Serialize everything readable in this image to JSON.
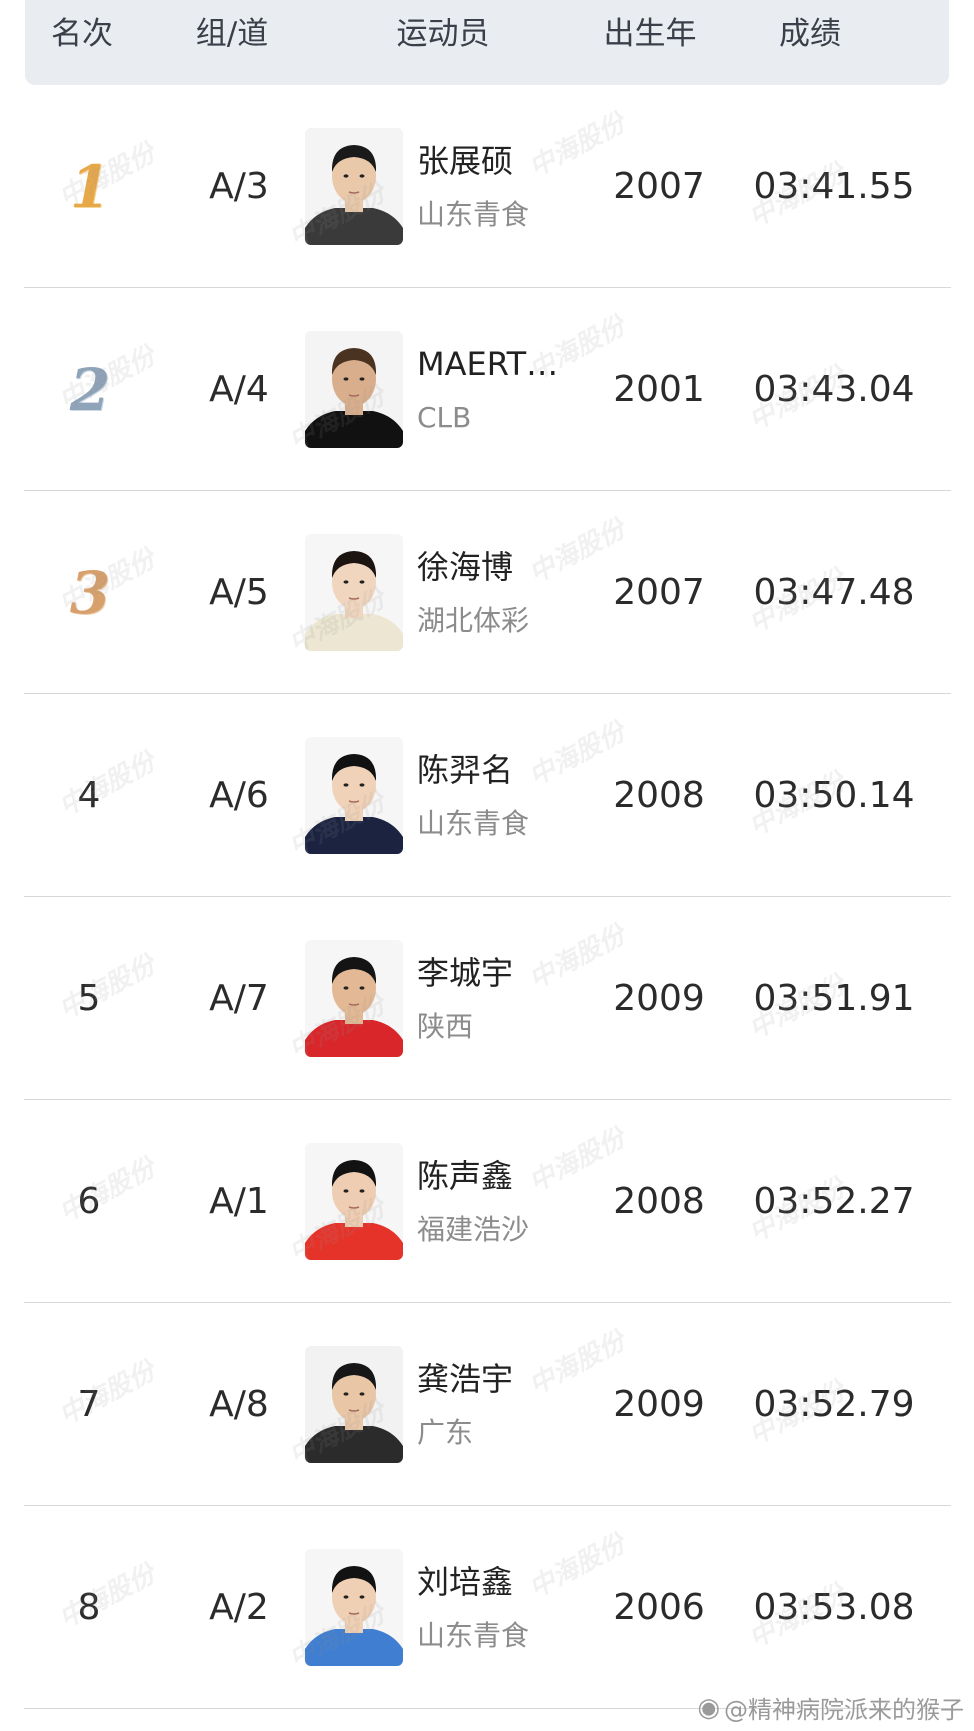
{
  "header": {
    "rank": "名次",
    "lane": "组/道",
    "athlete": "运动员",
    "birth_year": "出生年",
    "result": "成绩"
  },
  "rows": [
    {
      "rank": "1",
      "medal": "gold",
      "lane": "A/3",
      "name": "张展硕",
      "team": "山东青食",
      "year": "2007",
      "time": "03:41.55",
      "avatar": {
        "bg": "#f4f4f4",
        "shirt": "#3a3a3a",
        "hair": "#1a1a1a",
        "skin": "#e9c9aa"
      }
    },
    {
      "rank": "2",
      "medal": "silver",
      "lane": "A/4",
      "name": "MAERT…",
      "team": "CLB",
      "year": "2001",
      "time": "03:43.04",
      "avatar": {
        "bg": "#f4f4f4",
        "shirt": "#111111",
        "hair": "#4a3320",
        "skin": "#d9ae8c"
      }
    },
    {
      "rank": "3",
      "medal": "bronze",
      "lane": "A/5",
      "name": "徐海博",
      "team": "湖北体彩",
      "year": "2007",
      "time": "03:47.48",
      "avatar": {
        "bg": "#f6f6f6",
        "shirt": "#ece6d2",
        "hair": "#1c1410",
        "skin": "#f1d6bf"
      }
    },
    {
      "rank": "4",
      "medal": "",
      "lane": "A/6",
      "name": "陈羿名",
      "team": "山东青食",
      "year": "2008",
      "time": "03:50.14",
      "avatar": {
        "bg": "#f6f6f6",
        "shirt": "#1b2340",
        "hair": "#111111",
        "skin": "#f0d2b8"
      }
    },
    {
      "rank": "5",
      "medal": "",
      "lane": "A/7",
      "name": "李城宇",
      "team": "陕西",
      "year": "2009",
      "time": "03:51.91",
      "avatar": {
        "bg": "#f6f6f6",
        "shirt": "#d8262a",
        "hair": "#141414",
        "skin": "#e3b995"
      }
    },
    {
      "rank": "6",
      "medal": "",
      "lane": "A/1",
      "name": "陈声鑫",
      "team": "福建浩沙",
      "year": "2008",
      "time": "03:52.27",
      "avatar": {
        "bg": "#f6f6f6",
        "shirt": "#e6332a",
        "hair": "#121212",
        "skin": "#efcdb2"
      }
    },
    {
      "rank": "7",
      "medal": "",
      "lane": "A/8",
      "name": "龚浩宇",
      "team": "广东",
      "year": "2009",
      "time": "03:52.79",
      "avatar": {
        "bg": "#f2f2f2",
        "shirt": "#2b2b2b",
        "hair": "#161616",
        "skin": "#e8c6a6"
      }
    },
    {
      "rank": "8",
      "medal": "",
      "lane": "A/2",
      "name": "刘培鑫",
      "team": "山东青食",
      "year": "2006",
      "time": "03:53.08",
      "avatar": {
        "bg": "#f6f6f6",
        "shirt": "#3f7ed0",
        "hair": "#121212",
        "skin": "#f0d0b4"
      }
    }
  ],
  "watermark": "中海股份",
  "footer_credit": "@精神病院派来的猴子",
  "colors": {
    "header_bg": "#e9ecf1",
    "scroll_indicator": "#8fb0ee",
    "team_text": "#8c8c8c",
    "divider": "#d8d8d8"
  }
}
